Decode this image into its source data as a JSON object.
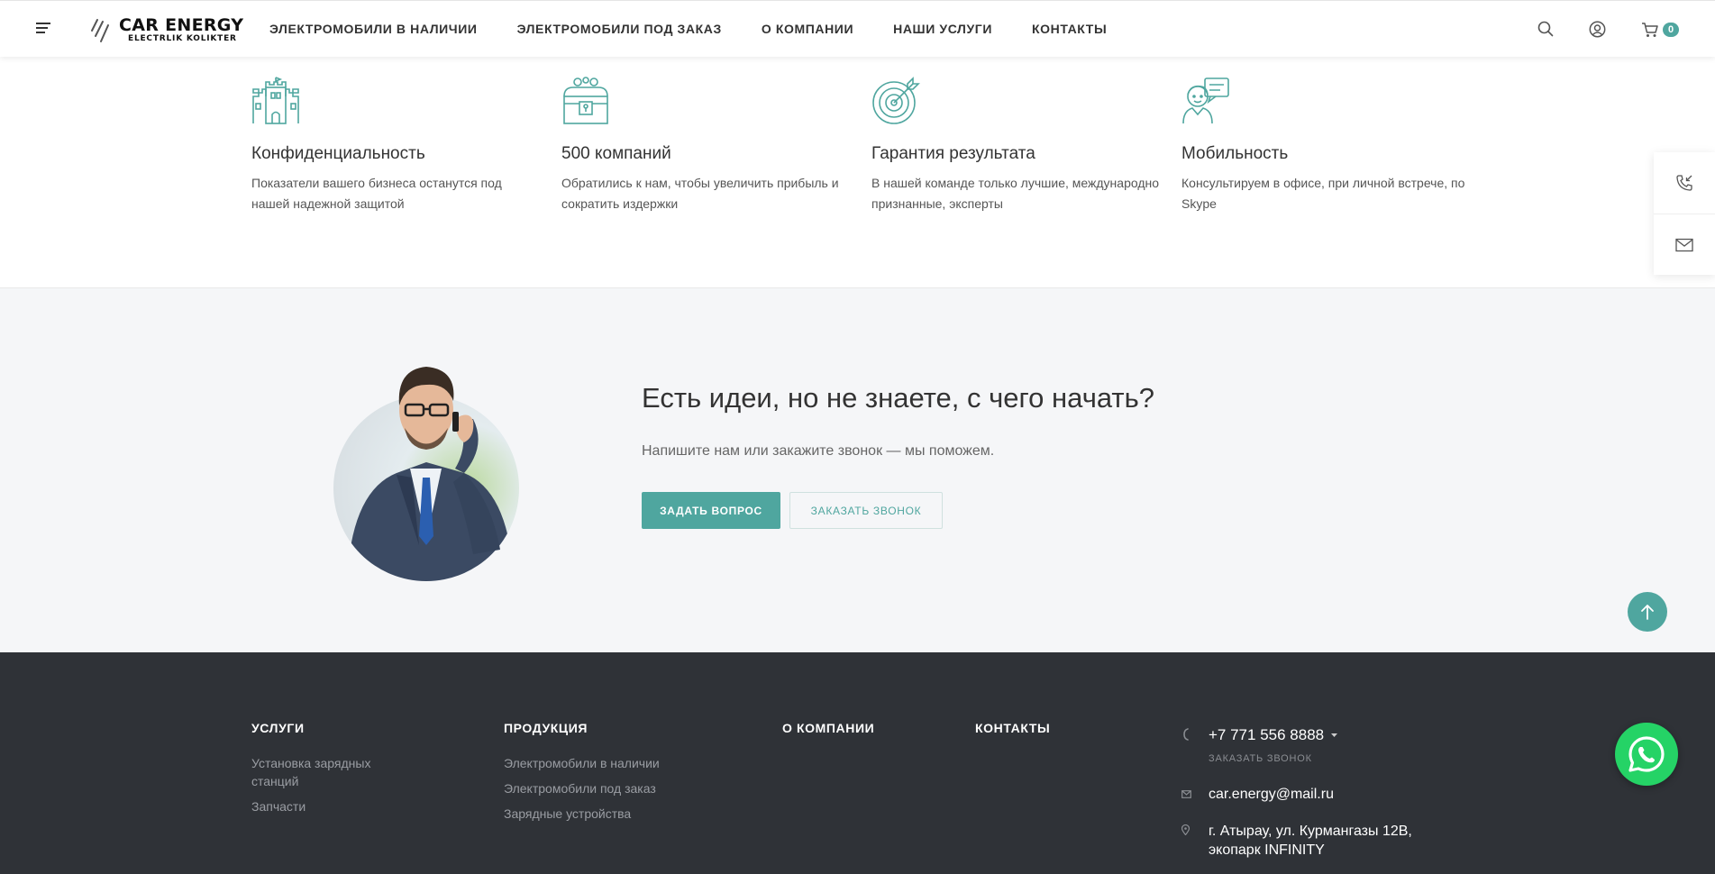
{
  "header": {
    "logo_main": "CAR ENERGY",
    "logo_sub": "ELECTRLIK KOLIKTER",
    "nav": [
      {
        "label": "ЭЛЕКТРОМОБИЛИ В НАЛИЧИИ"
      },
      {
        "label": "ЭЛЕКТРОМОБИЛИ ПОД ЗАКАЗ"
      },
      {
        "label": "О КОМПАНИИ"
      },
      {
        "label": "НАШИ УСЛУГИ"
      },
      {
        "label": "КОНТАКТЫ"
      }
    ],
    "cart_count": "0",
    "icons": [
      "menu-icon",
      "search-icon",
      "user-icon",
      "cart-icon"
    ]
  },
  "features": [
    {
      "title": "Конфиденциальность",
      "text": "Показатели вашего бизнеса останутся под нашей надежной защитой",
      "icon": "castle-icon"
    },
    {
      "title": "500 компаний",
      "text": "Обратились к нам, чтобы увеличить прибыль и сократить издержки",
      "icon": "treasure-chest-icon"
    },
    {
      "title": "Гарантия результата",
      "text": "В нашей команде только лучшие, международно признанные, эксперты",
      "icon": "target-icon"
    },
    {
      "title": "Мобильность",
      "text": "Консультируем в офисе, при личной встрече, по Skype",
      "icon": "consultant-icon"
    }
  ],
  "cta": {
    "title": "Есть идеи, но не знаете, с чего начать?",
    "subtitle": "Напишите нам или закажите звонок — мы поможем.",
    "ask_button": "ЗАДАТЬ ВОПРОС",
    "call_button": "ЗАКАЗАТЬ ЗВОНОК"
  },
  "footer": {
    "services": {
      "heading": "УСЛУГИ",
      "links": [
        "Установка зарядных станций",
        "Запчасти"
      ]
    },
    "products": {
      "heading": "ПРОДУКЦИЯ",
      "links": [
        "Электромобили в наличии",
        "Электромобили под заказ",
        "Зарядные устройства"
      ]
    },
    "company": {
      "heading": "О КОМПАНИИ"
    },
    "contacts": {
      "heading": "КОНТАКТЫ"
    },
    "phone": "+7 771 556 8888",
    "call_link": "ЗАКАЗАТЬ ЗВОНОК",
    "email": "car.energy@mail.ru",
    "address": "г. Атырау, ул. Курмангазы 12В, экопарк INFINITY"
  },
  "colors": {
    "accent": "#4fa69f",
    "footer_bg": "#2f3237",
    "section_bg": "#f5f6f8",
    "whatsapp": "#25d366"
  }
}
